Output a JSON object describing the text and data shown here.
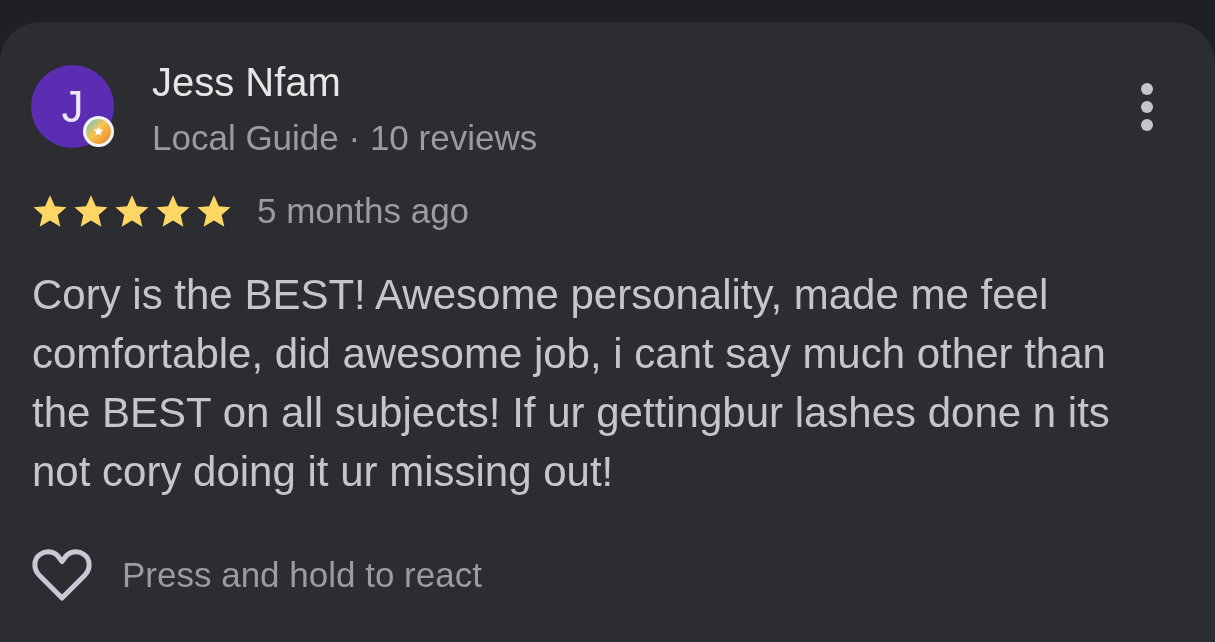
{
  "review": {
    "author": {
      "initial": "J",
      "name": "Jess Nfam",
      "subtitle": "Local Guide · 10 reviews",
      "local_guide": true
    },
    "stars": 5,
    "time": "5 months ago",
    "text": "Cory is the BEST! Awesome personality, made me feel comfortable, did awesome job, i cant say much other than the BEST on all subjects! If ur gettingbur lashes done n its not cory doing it ur missing out!",
    "react_hint": "Press and hold to react"
  }
}
